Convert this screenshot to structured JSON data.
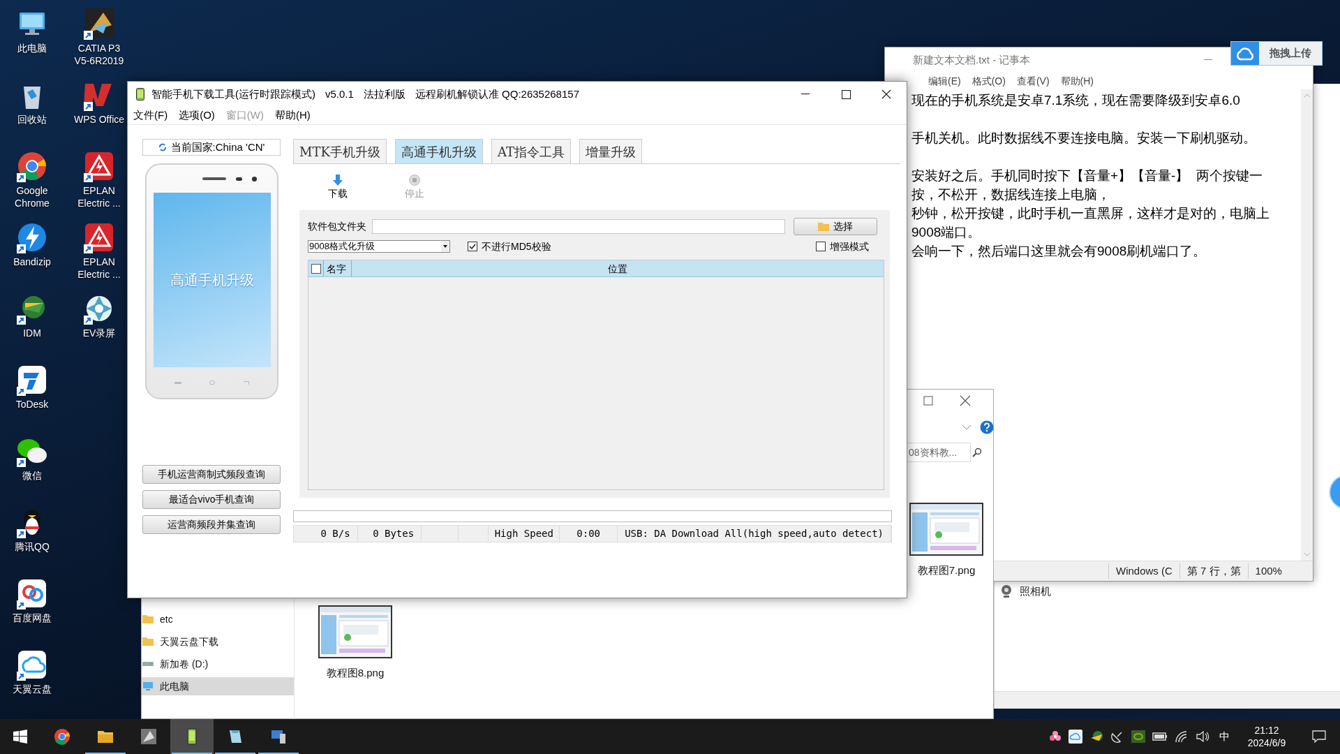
{
  "desktop_icons": [
    [
      {
        "label": "此电脑",
        "kind": "computer"
      },
      {
        "label": "回收站",
        "kind": "recycle"
      },
      {
        "label": "Google Chrome",
        "kind": "chrome"
      },
      {
        "label": "Bandizip",
        "kind": "bandizip"
      },
      {
        "label": "IDM",
        "kind": "idm"
      },
      {
        "label": "ToDesk",
        "kind": "todesk"
      },
      {
        "label": "微信",
        "kind": "wechat"
      },
      {
        "label": "腾讯QQ",
        "kind": "qq"
      },
      {
        "label": "百度网盘",
        "kind": "baidu"
      },
      {
        "label": "天翼云盘",
        "kind": "tianyi"
      }
    ],
    [
      {
        "label": "CATIA P3 V5-6R2019",
        "kind": "catia"
      },
      {
        "label": "WPS Office",
        "kind": "wps"
      },
      {
        "label": "EPLAN Electric ...",
        "kind": "eplan"
      },
      {
        "label": "EPLAN Electric ...",
        "kind": "eplan"
      },
      {
        "label": "EV录屏",
        "kind": "ev"
      }
    ]
  ],
  "upload_widget": {
    "label": "拖拽上传"
  },
  "notepad": {
    "title": "新建文本文档.txt - 记事本",
    "menu": [
      "编辑(E)",
      "格式(O)",
      "查看(V)",
      "帮助(H)"
    ],
    "paragraphs": [
      [
        "现在的手机系统是安卓7.1系统，现在需要降级到安卓6.0"
      ],
      [
        "手机关机。此时数据线不要连接电脑。安装一下刷机驱动。"
      ],
      [
        "安装好之后。手机同时按下【音量+】【音量-】  两个按键一",
        "按，不松开，数据线连接上电脑，",
        "秒钟，松开按键，此时手机一直黑屏，这样才是对的，电脑上",
        "9008端口。",
        "会响一下，然后端口这里就会有9008刷机端口了。"
      ]
    ],
    "status_bar": [
      "Windows (C",
      "第 7 行，第",
      "100%"
    ]
  },
  "explorer": {
    "search": {
      "placeholder": "08资料教..."
    },
    "nav_items": [
      {
        "label": "etc",
        "kind": "folder",
        "selected": false
      },
      {
        "label": "天翼云盘下载",
        "kind": "folder",
        "selected": false
      },
      {
        "label": "新加卷 (D:)",
        "kind": "drive",
        "selected": false
      },
      {
        "label": "此电脑",
        "kind": "computer",
        "selected": true
      }
    ],
    "files": [
      {
        "label": "教程图8.png"
      },
      {
        "label": "教程图7.png"
      }
    ]
  },
  "back_window": {
    "item": "照相机"
  },
  "main_window": {
    "title": [
      "智能手机下载工具(运行时跟踪模式)",
      "v5.0.1",
      "法拉利版",
      "远程刷机解锁认准 QQ:2635268157"
    ],
    "menu": [
      {
        "label": "文件(F)",
        "disabled": false
      },
      {
        "label": "选项(O)",
        "disabled": false
      },
      {
        "label": "窗口(W)",
        "disabled": true
      },
      {
        "label": "帮助(H)",
        "disabled": false
      }
    ],
    "country": "当前国家:China 'CN'",
    "phone_screen_text": "高通手机升级",
    "query_buttons": [
      "手机运营商制式频段查询",
      "最适合vivo手机查询",
      "运营商频段并集查询"
    ],
    "tabs": [
      {
        "label": "MTK手机升级",
        "selected": false
      },
      {
        "label": "高通手机升级",
        "selected": true
      },
      {
        "label": "AT指令工具",
        "selected": false
      },
      {
        "label": "增量升级",
        "selected": false
      }
    ],
    "toolbar": [
      {
        "label": "下载",
        "kind": "download",
        "disabled": false
      },
      {
        "label": "停止",
        "kind": "stop",
        "disabled": true
      }
    ],
    "folder_label": "软件包文件夹",
    "choose_button": "选择",
    "mode_select": "9008格式化升级",
    "checkboxes": [
      {
        "label": "不进行MD5校验",
        "checked": true
      },
      {
        "label": "增强模式",
        "checked": false
      }
    ],
    "table": {
      "select_all_checked": false,
      "columns": [
        "名字",
        "位置"
      ]
    },
    "progress": {
      "level": 0
    },
    "status_bar": [
      {
        "kind": "text",
        "text": "0 B/s"
      },
      {
        "kind": "text",
        "text": "0 Bytes"
      },
      {
        "kind": "blank"
      },
      {
        "kind": "blank"
      },
      {
        "kind": "text",
        "text": "High Speed"
      },
      {
        "kind": "text",
        "text": "0:00"
      },
      {
        "kind": "text",
        "text": "USB: DA Download All(high speed,auto detect)"
      }
    ]
  },
  "taskbar": {
    "apps": [
      {
        "kind": "chrome",
        "running": false,
        "active": false
      },
      {
        "kind": "folder",
        "running": true,
        "active": false
      },
      {
        "kind": "catia",
        "running": false,
        "active": false
      },
      {
        "kind": "phone",
        "running": true,
        "active": true
      },
      {
        "kind": "notepad",
        "running": true,
        "active": false
      },
      {
        "kind": "remote",
        "running": true,
        "active": false
      }
    ],
    "ime": "中",
    "time": "21:12",
    "date": "2024/6/9"
  }
}
